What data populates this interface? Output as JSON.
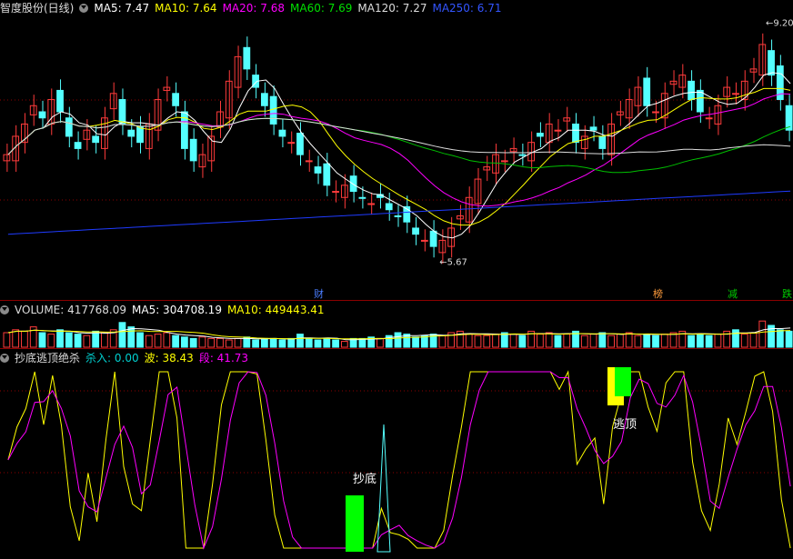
{
  "price_header": {
    "title": "智度股份(日线)",
    "ma5": "MA5: 7.47",
    "ma10": "MA10: 7.64",
    "ma20": "MA20: 7.68",
    "ma60": "MA60: 7.69",
    "ma120": "MA120: 7.27",
    "ma250": "MA250: 6.71"
  },
  "volume_header": {
    "volume": "VOLUME: 417768.09",
    "ma5": "MA5: 304708.19",
    "ma10": "MA10: 449443.41"
  },
  "indicator_header": {
    "title": "抄底逃顶绝杀",
    "kill": "杀入: 0.00",
    "wave": "波: 38.43",
    "segment": "段: 41.73"
  },
  "colors": {
    "up": "#ff3b3b",
    "down": "#54ffff",
    "ma5": "#ffffff",
    "ma10": "#ffff00",
    "ma20": "#ff00ff",
    "ma60": "#00c000",
    "ma120": "#dddddd",
    "ma250": "#1f3bff",
    "kill_bar": "#00ff00",
    "top_bar_yellow": "#ffff00",
    "grid": "#8b0000"
  },
  "chart_data": [
    {
      "type": "candlestick",
      "title": "智度股份(日线)",
      "ylim": [
        5.0,
        9.5
      ],
      "high_marker": "9.20",
      "low_marker": "5.67",
      "event_tags": [
        "财",
        "榜",
        "减",
        "跌"
      ],
      "series": [
        {
          "name": "MA5",
          "last": 7.47
        },
        {
          "name": "MA10",
          "last": 7.64
        },
        {
          "name": "MA20",
          "last": 7.68
        },
        {
          "name": "MA60",
          "last": 7.69
        },
        {
          "name": "MA120",
          "last": 7.27
        },
        {
          "name": "MA250",
          "last": 6.71
        }
      ],
      "close": [
        7.3,
        7.6,
        7.8,
        8.1,
        7.9,
        8.2,
        8.0,
        7.6,
        7.4,
        7.7,
        7.5,
        7.9,
        8.3,
        7.8,
        7.6,
        7.5,
        7.8,
        8.2,
        8.4,
        8.1,
        7.4,
        7.2,
        7.3,
        7.6,
        8.0,
        8.5,
        8.9,
        8.7,
        8.4,
        8.1,
        7.8,
        7.6,
        7.5,
        7.3,
        7.2,
        7.0,
        6.8,
        6.7,
        6.8,
        6.7,
        6.6,
        6.5,
        6.6,
        6.4,
        6.3,
        6.2,
        6.0,
        5.9,
        5.8,
        5.9,
        6.1,
        6.3,
        6.6,
        6.9,
        7.1,
        7.3,
        7.2,
        7.4,
        7.3,
        7.5,
        7.6,
        7.8,
        7.7,
        7.9,
        7.5,
        7.6,
        7.7,
        7.4,
        7.8,
        8.0,
        8.2,
        8.4,
        8.1,
        8.0,
        8.3,
        8.5,
        8.6,
        8.2,
        8.0,
        7.9,
        8.1,
        8.4,
        8.3,
        8.5,
        8.7,
        9.1,
        8.6,
        8.2,
        7.7
      ]
    },
    {
      "type": "bar",
      "title": "VOLUME",
      "series": [
        {
          "name": "VOLUME",
          "last": 417768.09
        },
        {
          "name": "MA5",
          "last": 304708.19
        },
        {
          "name": "MA10",
          "last": 449443.41
        }
      ],
      "values": [
        0.5,
        0.6,
        0.55,
        0.7,
        0.5,
        0.45,
        0.6,
        0.5,
        0.45,
        0.4,
        0.55,
        0.5,
        0.6,
        0.85,
        0.7,
        0.5,
        0.4,
        0.45,
        0.5,
        0.4,
        0.35,
        0.3,
        0.35,
        0.3,
        0.3,
        0.25,
        0.3,
        0.35,
        0.25,
        0.3,
        0.3,
        0.25,
        0.3,
        0.45,
        0.3,
        0.25,
        0.3,
        0.25,
        0.2,
        0.3,
        0.3,
        0.35,
        0.3,
        0.4,
        0.5,
        0.45,
        0.35,
        0.4,
        0.45,
        0.4,
        0.5,
        0.55,
        0.45,
        0.4,
        0.4,
        0.45,
        0.5,
        0.45,
        0.4,
        0.55,
        0.45,
        0.5,
        0.4,
        0.45,
        0.55,
        0.4,
        0.45,
        0.5,
        0.4,
        0.45,
        0.5,
        0.4,
        0.45,
        0.4,
        0.45,
        0.5,
        0.55,
        0.4,
        0.45,
        0.4,
        0.45,
        0.55,
        0.6,
        0.45,
        0.5,
        0.9,
        0.75,
        0.6,
        0.55
      ]
    },
    {
      "type": "line",
      "title": "抄底逃顶绝杀",
      "annotations": [
        "抄底",
        "逃顶"
      ],
      "series": [
        {
          "name": "杀入",
          "last": 0.0
        },
        {
          "name": "波",
          "last": 38.43
        },
        {
          "name": "段",
          "last": 41.73
        }
      ]
    }
  ]
}
